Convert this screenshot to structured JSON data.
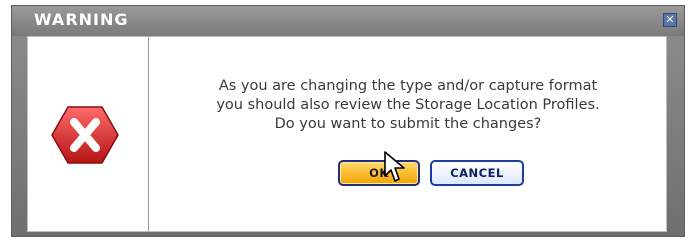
{
  "dialog": {
    "title": "WARNING",
    "close_icon": "close-x-icon",
    "status_icon": "error-x-icon",
    "message_lines": [
      "As you are changing the type and/or capture format",
      "you should also review the Storage Location Profiles.",
      "Do you want to submit the changes?"
    ],
    "ok_label": "OK",
    "cancel_label": "CANCEL"
  },
  "colors": {
    "error_red": "#d42a2a",
    "ok_button": "#f5b400",
    "button_border": "#1f2f7a",
    "titlebar": "#8a8a8a"
  }
}
